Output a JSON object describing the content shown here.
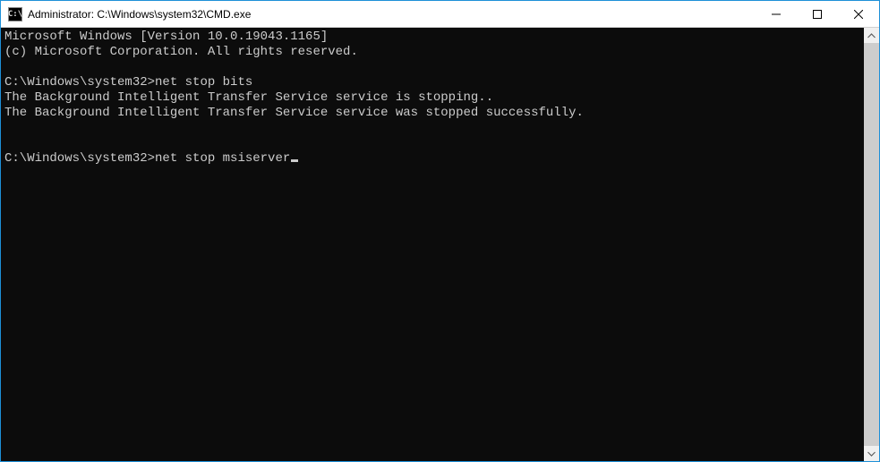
{
  "window": {
    "title": "Administrator: C:\\Windows\\system32\\CMD.exe",
    "icon_glyph": "C:\\"
  },
  "terminal": {
    "lines": [
      {
        "type": "text",
        "text": "Microsoft Windows [Version 10.0.19043.1165]"
      },
      {
        "type": "text",
        "text": "(c) Microsoft Corporation. All rights reserved."
      },
      {
        "type": "blank"
      },
      {
        "type": "cmd",
        "prompt": "C:\\Windows\\system32>",
        "input": "net stop bits"
      },
      {
        "type": "text",
        "text": "The Background Intelligent Transfer Service service is stopping.."
      },
      {
        "type": "text",
        "text": "The Background Intelligent Transfer Service service was stopped successfully."
      },
      {
        "type": "blank"
      },
      {
        "type": "blank"
      },
      {
        "type": "cmd-active",
        "prompt": "C:\\Windows\\system32>",
        "input": "net stop msiserver"
      }
    ]
  }
}
